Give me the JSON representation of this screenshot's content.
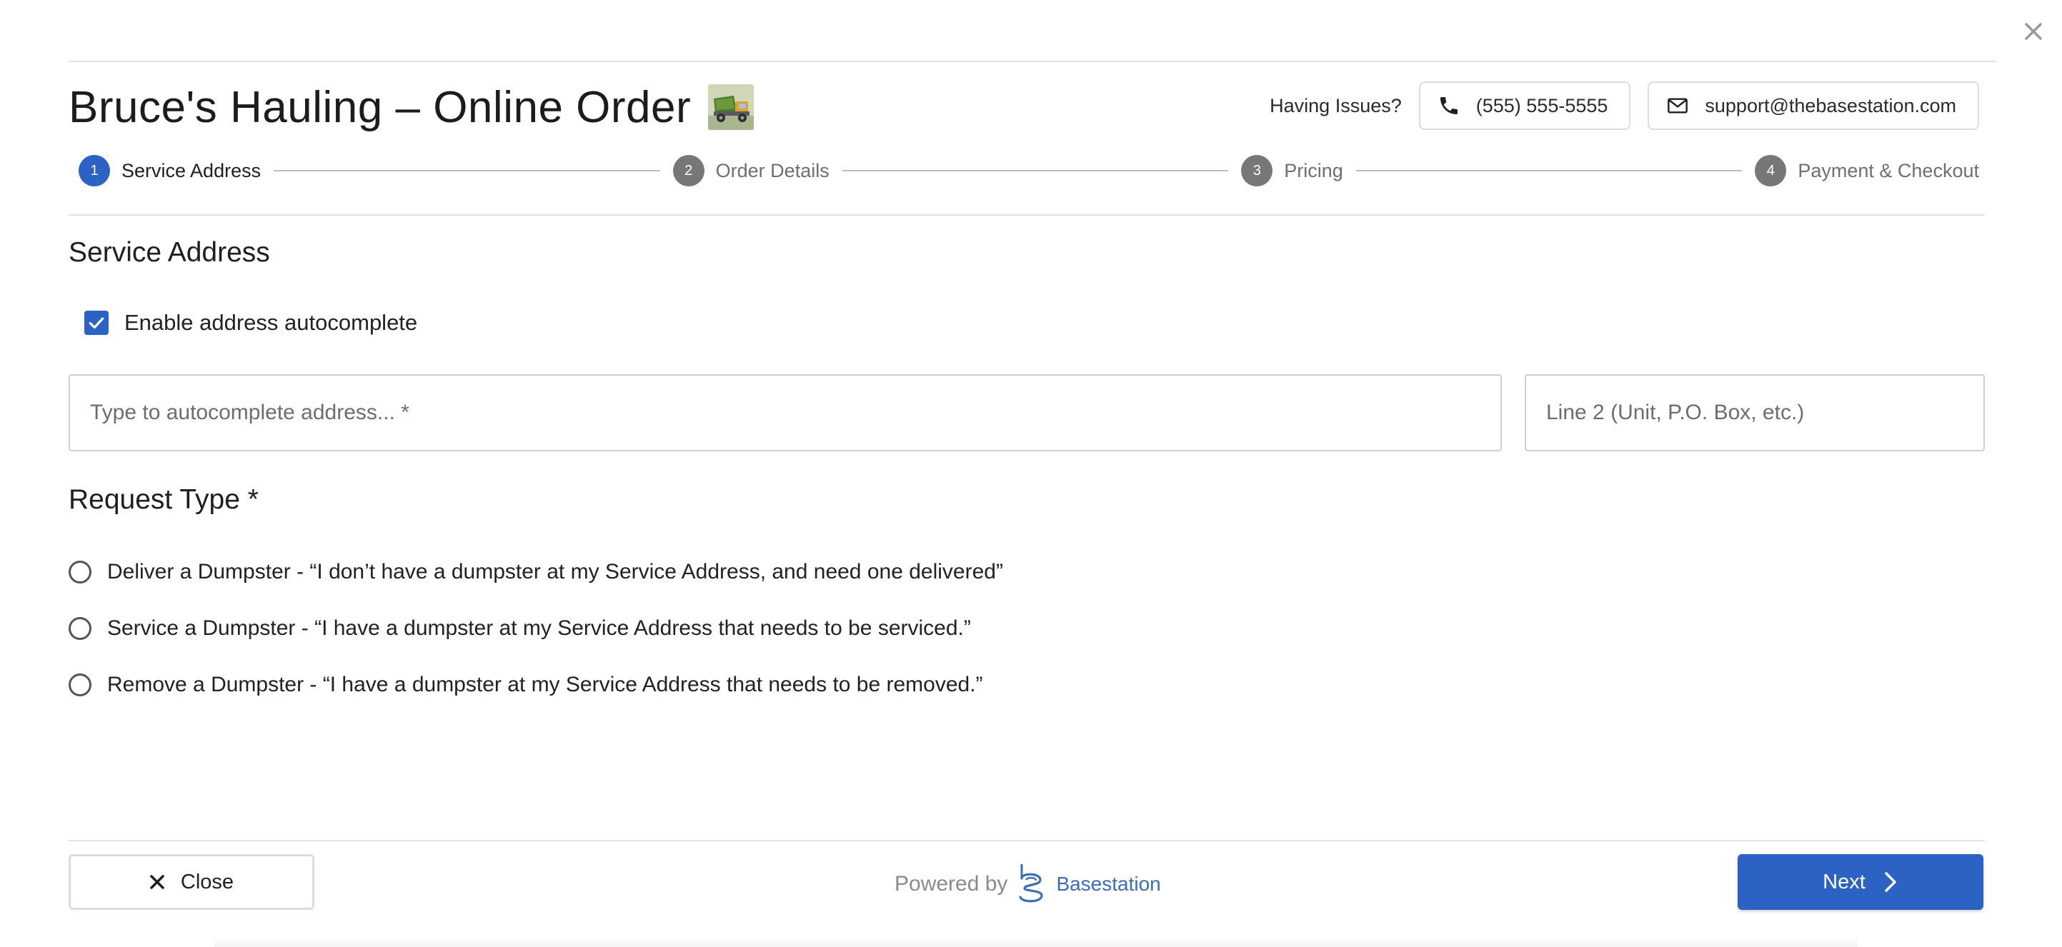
{
  "header": {
    "title": "Bruce's Hauling – Online Order",
    "having_issues": "Having Issues?",
    "phone": "(555) 555-5555",
    "email": "support@thebasestation.com"
  },
  "stepper": {
    "steps": [
      {
        "number": "1",
        "label": "Service Address",
        "active": true
      },
      {
        "number": "2",
        "label": "Order Details",
        "active": false
      },
      {
        "number": "3",
        "label": "Pricing",
        "active": false
      },
      {
        "number": "4",
        "label": "Payment & Checkout",
        "active": false
      }
    ]
  },
  "service_address": {
    "heading": "Service Address",
    "autocomplete_label": "Enable address autocomplete",
    "autocomplete_checked": true,
    "address_value": "",
    "address_placeholder": "Type to autocomplete address... *",
    "line2_value": "",
    "line2_placeholder": "Line 2 (Unit, P.O. Box, etc.)"
  },
  "request_type": {
    "heading": "Request Type *",
    "options": [
      {
        "label": "Deliver a Dumpster - “I don’t have a dumpster at my Service Address, and need one delivered”",
        "selected": false
      },
      {
        "label": "Service a Dumpster - “I have a dumpster at my Service Address that needs to be serviced.”",
        "selected": false
      },
      {
        "label": "Remove a Dumpster - “I have a dumpster at my Service Address that needs to be removed.”",
        "selected": false
      }
    ]
  },
  "footer": {
    "close_label": "Close",
    "powered_by": "Powered by",
    "brand": "Basestation",
    "next_label": "Next"
  },
  "icons": {
    "dismiss": "close-icon",
    "phone": "phone-icon",
    "email": "envelope-icon",
    "checkbox": "checkmark-icon",
    "close": "close-icon",
    "next": "chevron-right-icon",
    "brand": "basestation-logo-icon",
    "logo": "dump-truck-logo"
  },
  "colors": {
    "accent": "#2b62c3",
    "step_inactive": "#777777",
    "brand_text": "#3d6cb8"
  }
}
